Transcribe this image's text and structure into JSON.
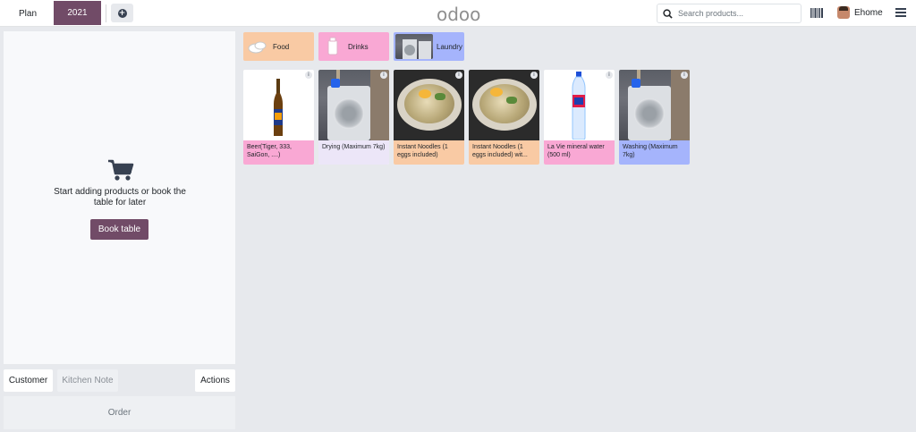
{
  "navbar": {
    "plan_label": "Plan",
    "table_label": "2021",
    "add_icon": "plus-circle-icon",
    "logo": "odoo",
    "search_placeholder": "Search products...",
    "barcode_icon": "barcode-icon",
    "user_name": "Ehome",
    "menu_icon": "hamburger-menu-icon"
  },
  "order": {
    "empty_message": "Start adding products or book the table for later",
    "book_table_label": "Book table",
    "cart_icon": "shopping-cart-icon"
  },
  "controls": {
    "customer_label": "Customer",
    "kitchen_note_label": "Kitchen Note",
    "actions_label": "Actions",
    "order_label": "Order"
  },
  "categories": [
    {
      "label": "Food",
      "color": "#f9caa4"
    },
    {
      "label": "Drinks",
      "color": "#f9a8d4"
    },
    {
      "label": "Laundry",
      "color": "#a5b4fc"
    }
  ],
  "products": [
    {
      "name": "Beer(Tiger, 333, SaiGon, ....)",
      "category": "Drinks",
      "color": "#f9a8d4",
      "image": "beer-bottle"
    },
    {
      "name": "Drying (Maximum 7kg)",
      "category": "Laundry",
      "color": "#ece6f8",
      "image": "washing-machine"
    },
    {
      "name": "Instant Noodles (1 eggs included)",
      "category": "Food",
      "color": "#f9caa4",
      "image": "noodle-bowl"
    },
    {
      "name": "Instant Noodles (1 eggs included) wit...",
      "category": "Food",
      "color": "#f9caa4",
      "image": "noodle-bowl"
    },
    {
      "name": "La Vie mineral water (500 ml)",
      "category": "Drinks",
      "color": "#f9a8d4",
      "image": "water-bottle"
    },
    {
      "name": "Washing (Maximum 7kg)",
      "category": "Laundry",
      "color": "#a5b4fc",
      "image": "washing-machine"
    }
  ],
  "colors": {
    "brand": "#714b67",
    "background": "#e7e9ed"
  }
}
